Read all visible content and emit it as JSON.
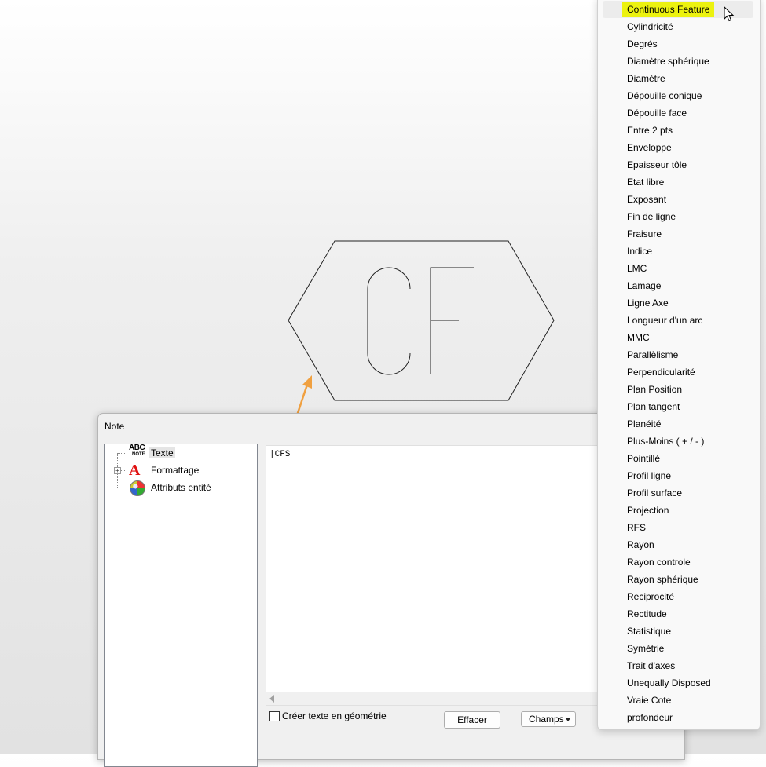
{
  "canvas": {
    "symbol_text": "CF"
  },
  "dialog": {
    "title": "Note",
    "tree": [
      {
        "label": "Texte",
        "icon": "abc-note-icon",
        "selected": true
      },
      {
        "label": "Formattage",
        "icon": "text-format-a-icon",
        "expander": "+"
      },
      {
        "label": "Attributs entité",
        "icon": "palette-icon"
      }
    ],
    "abc_icon_top": "ABC",
    "abc_icon_bottom": "NOTE",
    "editor_text": "|CFS",
    "checkbox_label": "Créer texte en géométrie",
    "effacer_label": "Effacer",
    "champs_label": "Champs"
  },
  "menu": {
    "highlight_color": "#ecf20f",
    "items": [
      "Continuous Feature",
      "Cylindricité",
      "Degrés",
      "Diamètre sphérique",
      "Diamétre",
      "Dépouille conique",
      "Dépouille face",
      "Entre 2 pts",
      "Enveloppe",
      "Epaisseur tôle",
      "Etat libre",
      "Exposant",
      "Fin de ligne",
      "Fraisure",
      "Indice",
      "LMC",
      "Lamage",
      "Ligne Axe",
      "Longueur d'un arc",
      "MMC",
      "Parallèlisme",
      "Perpendicularité",
      "Plan Position",
      "Plan tangent",
      "Planéité",
      "Plus-Moins ( + / - )",
      "Pointillé",
      "Profil ligne",
      "Profil surface",
      "Projection",
      "RFS",
      "Rayon",
      "Rayon controle",
      "Rayon sphérique",
      "Reciprocité",
      "Rectitude",
      "Statistique",
      "Symétrie",
      "Trait d'axes",
      "Unequally Disposed",
      "Vraie Cote",
      "profondeur"
    ]
  }
}
